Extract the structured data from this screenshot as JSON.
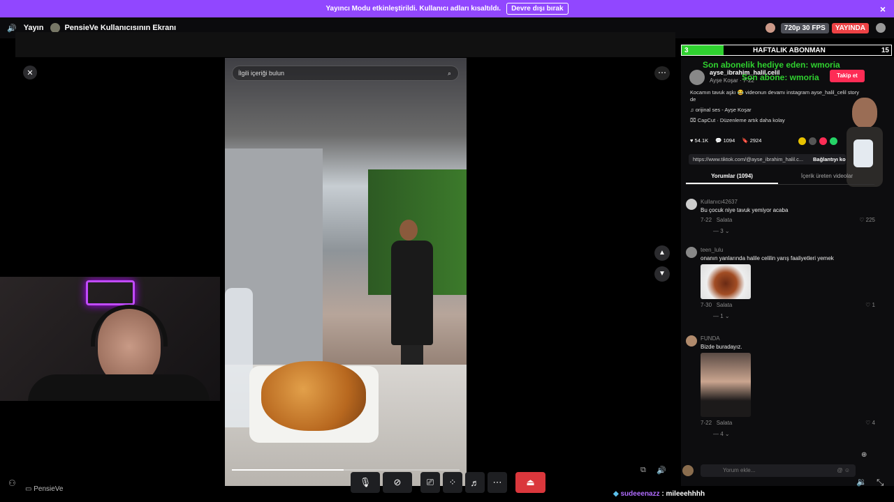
{
  "banner": {
    "message": "Yayıncı Modu etkinleştirildi. Kullanıcı adları kısaltıldı.",
    "button": "Devre dışı bırak",
    "close_icon": "×",
    "color": "#9147ff"
  },
  "callbar": {
    "stream_label": "Yayın",
    "title": "PensieVe Kullanıcısının Ekranı",
    "quality": "720p 30 FPS",
    "live": "YAYINDA",
    "live_color": "#ed4245"
  },
  "overlay": {
    "sub_count": "3",
    "sub_goal_label": "HAFTALIK ABONMAN",
    "sub_goal": "15",
    "gift_line": "Son abonelik hediye eden: wmoria",
    "sub_line": "Son abone: wmoria",
    "accent": "#2fd12f"
  },
  "tiktok": {
    "search_placeholder": "İlgili içeriği bulun",
    "username": "ayse_ibrahim_halil.celil",
    "display_name": "Ayşe Koşar · 7-22",
    "follow": "Takip et",
    "caption": "Kocamın tavuk aşkı 😂 videonun devamı instagram ayse_halil_celil story de",
    "sound": "orijinal ses - Ayşe Koşar",
    "capcut": "CapCut · Düzenleme artık daha kolay",
    "likes": "54.1K",
    "comments": "1094",
    "saves": "2924",
    "link": "https://www.tiktok.com/@ayse_ibrahim_halil.c...",
    "copy_link": "Bağlantıyı kopyala",
    "tab_comments": "Yorumlar (1094)",
    "tab_creator": "İçerik üreten videolar",
    "comment_placeholder": "Yorum ekle...",
    "comments_list": [
      {
        "user": "Kullanıcı42637",
        "text": "Bu çocuk niye tavuk yemiyor acaba",
        "date": "7-22",
        "reply": "Salata",
        "likes": "225",
        "replies": "3"
      },
      {
        "user": "teen_lulu",
        "text": "onanın yanlarında halile celilin yarış faaliyetleri yemek",
        "date": "7-30",
        "reply": "Salata",
        "likes": "1",
        "replies": "1"
      },
      {
        "user": "FUNDA",
        "text": "Bizde buradayız.",
        "date": "7-22",
        "reply": "Salata",
        "likes": "4",
        "replies": "4"
      }
    ]
  },
  "webcam_label": "PensieVe",
  "chat": {
    "user": "sudeeenazz",
    "message": ": mileeehhhh"
  }
}
